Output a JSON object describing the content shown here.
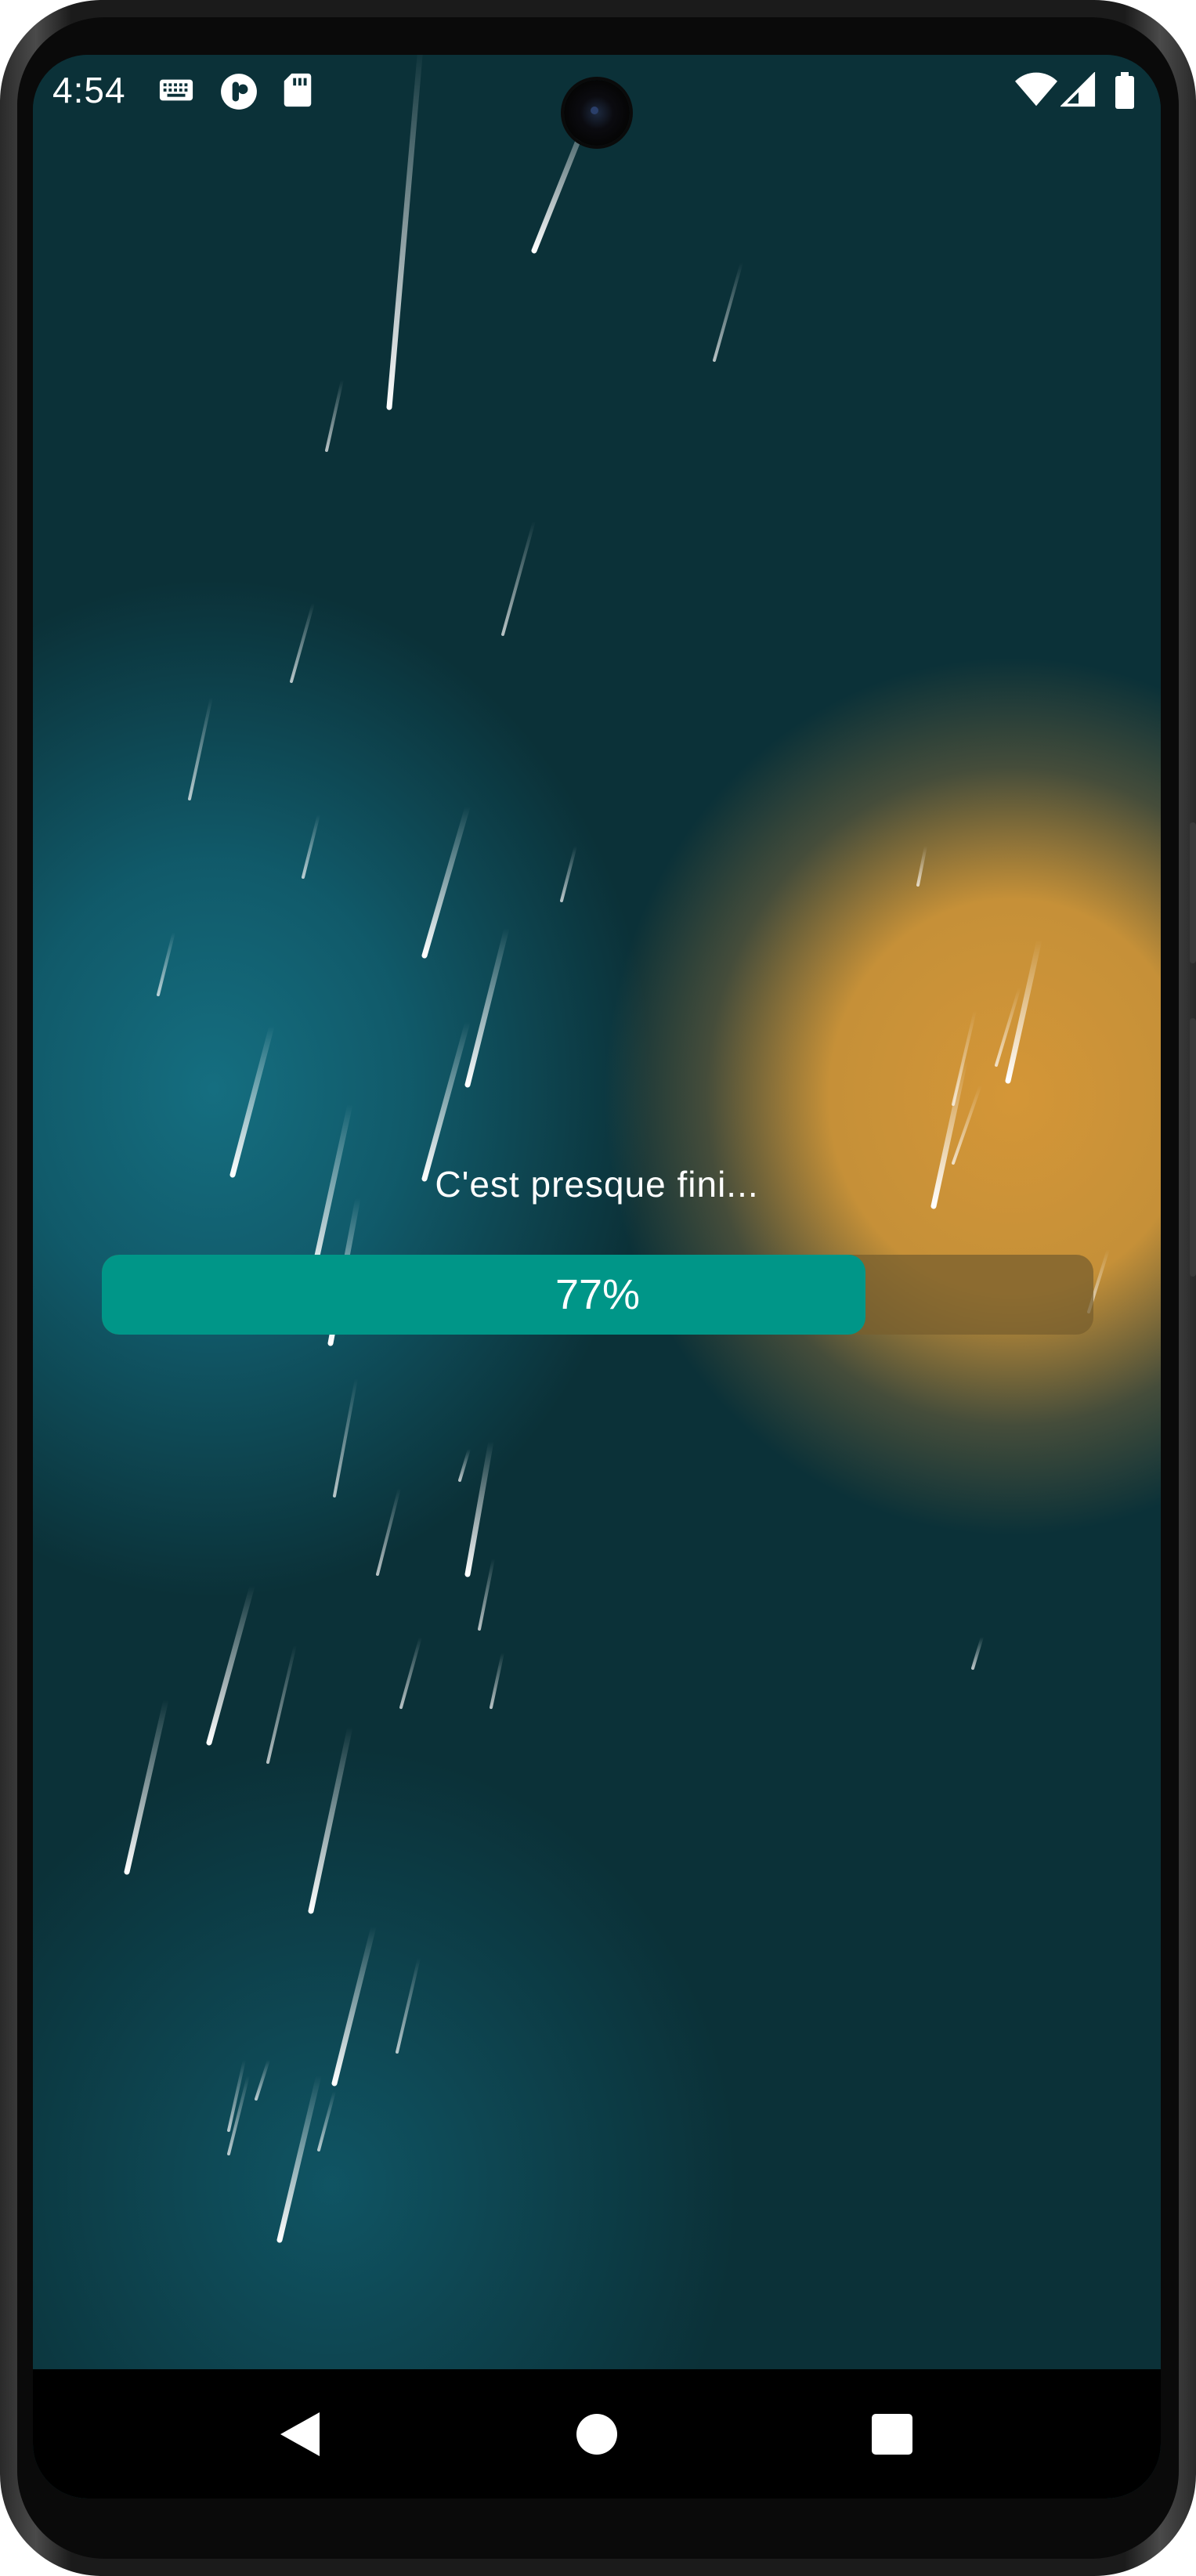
{
  "status_bar": {
    "time": "4:54",
    "left_icons": [
      "keyboard-icon",
      "assistant-icon",
      "sd-card-icon"
    ],
    "right_icons": [
      "wifi-icon",
      "cellular-signal-icon",
      "battery-icon"
    ]
  },
  "loading": {
    "message": "C'est presque fini...",
    "progress_value": 77,
    "progress_label": "77%"
  },
  "colors": {
    "background": "#0b3138",
    "blue_glow": "#156e80",
    "amber_glow": "#d49637",
    "progress_fill": "#009688",
    "progress_track": "#785f2d"
  },
  "nav_bar": {
    "buttons": [
      "back-icon",
      "home-icon",
      "recents-icon"
    ]
  }
}
